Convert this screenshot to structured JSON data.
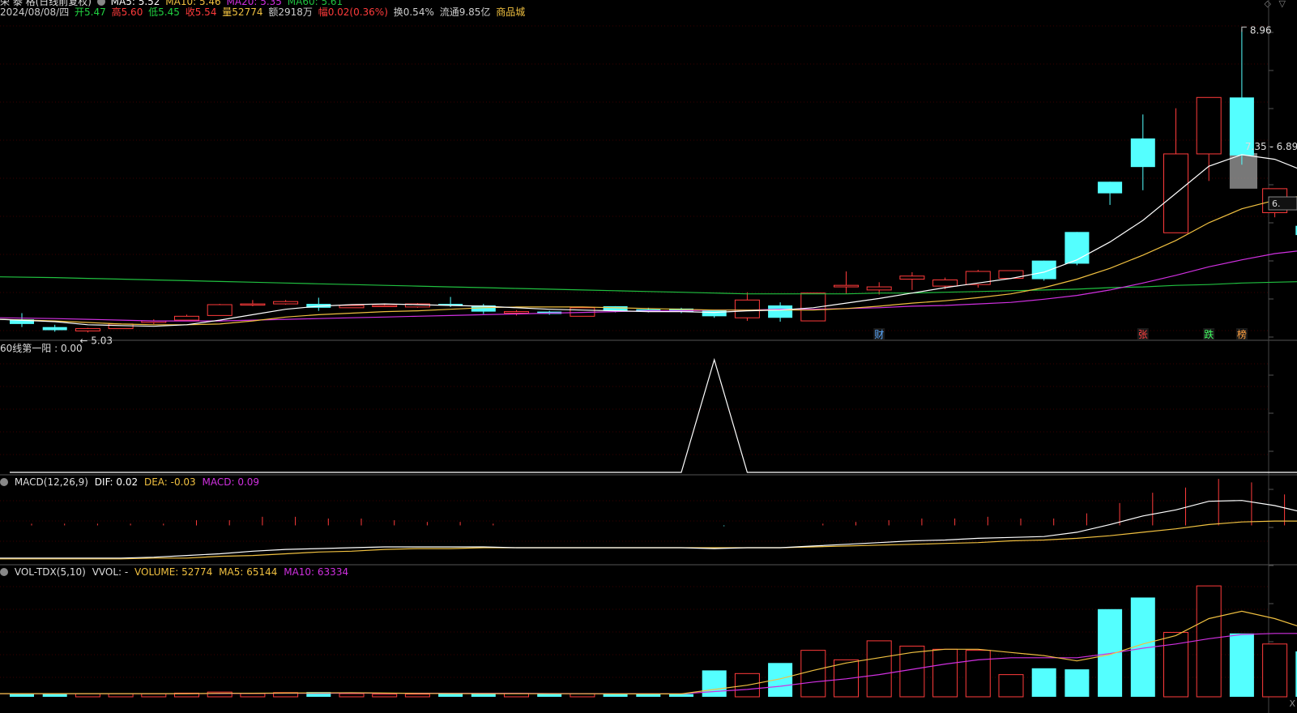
{
  "header": {
    "stock_name": "荣 泰 格(日线前复权)",
    "ma_row": [
      "MA5: 5.52",
      "MA10: 5.46",
      "MA20: 5.35",
      "MA60: 5.61"
    ],
    "date": "2024/08/08/四",
    "open": "开5.47",
    "high": "高5.60",
    "low": "低5.45",
    "close": "收5.54",
    "volume": "量52774",
    "amount": "额2918万",
    "change": "幅0.02(0.36%)",
    "turnover": "换0.54%",
    "float": "流通9.85亿",
    "category": "商品城"
  },
  "colors": {
    "up": "#ff3b3b",
    "down": "#54ffff",
    "ma5": "#ffffff",
    "ma10": "#f0c040",
    "ma20": "#d030e0",
    "ma60": "#20c040",
    "grid": "#3a0000",
    "text": "#cccccc"
  },
  "chart_data": [
    {
      "type": "candlestick",
      "name": "price",
      "candles": [
        {
          "o": 5.2,
          "h": 5.28,
          "l": 5.1,
          "c": 5.14
        },
        {
          "o": 5.1,
          "h": 5.13,
          "l": 5.04,
          "c": 5.06
        },
        {
          "o": 5.05,
          "h": 5.09,
          "l": 5.03,
          "c": 5.08
        },
        {
          "o": 5.08,
          "h": 5.15,
          "l": 5.08,
          "c": 5.14
        },
        {
          "o": 5.16,
          "h": 5.2,
          "l": 5.14,
          "c": 5.18
        },
        {
          "o": 5.19,
          "h": 5.26,
          "l": 5.18,
          "c": 5.24
        },
        {
          "o": 5.25,
          "h": 5.4,
          "l": 5.25,
          "c": 5.39
        },
        {
          "o": 5.4,
          "h": 5.45,
          "l": 5.37,
          "c": 5.4
        },
        {
          "o": 5.4,
          "h": 5.45,
          "l": 5.39,
          "c": 5.43
        },
        {
          "o": 5.4,
          "h": 5.48,
          "l": 5.31,
          "c": 5.35
        },
        {
          "o": 5.35,
          "h": 5.39,
          "l": 5.35,
          "c": 5.38
        },
        {
          "o": 5.38,
          "h": 5.4,
          "l": 5.36,
          "c": 5.38
        },
        {
          "o": 5.36,
          "h": 5.41,
          "l": 5.35,
          "c": 5.4
        },
        {
          "o": 5.4,
          "h": 5.49,
          "l": 5.36,
          "c": 5.38
        },
        {
          "o": 5.38,
          "h": 5.4,
          "l": 5.27,
          "c": 5.3
        },
        {
          "o": 5.28,
          "h": 5.32,
          "l": 5.25,
          "c": 5.3
        },
        {
          "o": 5.3,
          "h": 5.31,
          "l": 5.26,
          "c": 5.27
        },
        {
          "o": 5.24,
          "h": 5.36,
          "l": 5.24,
          "c": 5.35
        },
        {
          "o": 5.37,
          "h": 5.37,
          "l": 5.29,
          "c": 5.31
        },
        {
          "o": 5.33,
          "h": 5.35,
          "l": 5.29,
          "c": 5.3
        },
        {
          "o": 5.34,
          "h": 5.35,
          "l": 5.28,
          "c": 5.3
        },
        {
          "o": 5.32,
          "h": 5.32,
          "l": 5.22,
          "c": 5.24
        },
        {
          "o": 5.22,
          "h": 5.55,
          "l": 5.18,
          "c": 5.45
        },
        {
          "o": 5.38,
          "h": 5.42,
          "l": 5.17,
          "c": 5.22
        },
        {
          "o": 5.18,
          "h": 5.54,
          "l": 5.18,
          "c": 5.54
        },
        {
          "o": 5.62,
          "h": 5.82,
          "l": 5.53,
          "c": 5.64
        },
        {
          "o": 5.58,
          "h": 5.68,
          "l": 5.52,
          "c": 5.62
        },
        {
          "o": 5.72,
          "h": 5.81,
          "l": 5.58,
          "c": 5.76
        },
        {
          "o": 5.63,
          "h": 5.74,
          "l": 5.59,
          "c": 5.71
        },
        {
          "o": 5.65,
          "h": 5.84,
          "l": 5.61,
          "c": 5.82
        },
        {
          "o": 5.73,
          "h": 5.83,
          "l": 5.72,
          "c": 5.83
        },
        {
          "o": 5.96,
          "h": 5.96,
          "l": 5.7,
          "c": 5.72
        },
        {
          "o": 6.33,
          "h": 6.33,
          "l": 5.9,
          "c": 5.92
        },
        {
          "o": 6.98,
          "h": 6.98,
          "l": 6.68,
          "c": 6.83
        },
        {
          "o": 7.54,
          "h": 7.85,
          "l": 6.87,
          "c": 7.17
        },
        {
          "o": 6.32,
          "h": 7.93,
          "l": 6.32,
          "c": 7.34
        },
        {
          "o": 7.34,
          "h": 8.07,
          "l": 6.99,
          "c": 8.07
        },
        {
          "o": 8.07,
          "h": 8.96,
          "l": 7.2,
          "c": 7.32
        },
        {
          "o": 6.58,
          "h": 6.89,
          "l": 6.52,
          "c": 6.89
        },
        {
          "o": 6.41,
          "h": 6.58,
          "l": 6.23,
          "c": 6.29
        },
        {
          "o": 6.26,
          "h": 6.26,
          "l": 5.9,
          "c": 5.9
        }
      ],
      "ma5": [
        5.2,
        5.17,
        5.13,
        5.12,
        5.11,
        5.13,
        5.19,
        5.26,
        5.33,
        5.37,
        5.39,
        5.4,
        5.39,
        5.38,
        5.37,
        5.35,
        5.33,
        5.32,
        5.31,
        5.3,
        5.3,
        5.29,
        5.31,
        5.32,
        5.35,
        5.41,
        5.47,
        5.54,
        5.61,
        5.67,
        5.73,
        5.81,
        5.97,
        6.2,
        6.48,
        6.83,
        7.18,
        7.33,
        7.27,
        7.1,
        6.69
      ],
      "ma10": [
        5.2,
        5.18,
        5.16,
        5.14,
        5.13,
        5.13,
        5.14,
        5.18,
        5.23,
        5.26,
        5.28,
        5.3,
        5.31,
        5.33,
        5.35,
        5.36,
        5.36,
        5.36,
        5.35,
        5.34,
        5.33,
        5.32,
        5.32,
        5.32,
        5.32,
        5.34,
        5.37,
        5.41,
        5.44,
        5.48,
        5.53,
        5.61,
        5.72,
        5.86,
        6.03,
        6.22,
        6.45,
        6.63,
        6.74,
        6.81,
        6.77
      ],
      "ma20": [
        5.22,
        5.21,
        5.2,
        5.19,
        5.18,
        5.18,
        5.18,
        5.19,
        5.2,
        5.21,
        5.22,
        5.23,
        5.24,
        5.25,
        5.26,
        5.27,
        5.28,
        5.29,
        5.3,
        5.31,
        5.31,
        5.32,
        5.32,
        5.33,
        5.33,
        5.34,
        5.35,
        5.37,
        5.38,
        5.4,
        5.42,
        5.46,
        5.51,
        5.58,
        5.67,
        5.77,
        5.88,
        5.97,
        6.05,
        6.1,
        6.11
      ],
      "ma60": [
        5.75,
        5.74,
        5.73,
        5.72,
        5.71,
        5.7,
        5.69,
        5.68,
        5.67,
        5.66,
        5.65,
        5.64,
        5.63,
        5.62,
        5.61,
        5.6,
        5.59,
        5.58,
        5.57,
        5.56,
        5.55,
        5.54,
        5.53,
        5.53,
        5.53,
        5.53,
        5.54,
        5.54,
        5.55,
        5.56,
        5.57,
        5.58,
        5.59,
        5.61,
        5.62,
        5.64,
        5.65,
        5.67,
        5.68,
        5.69,
        5.7
      ],
      "ylim": [
        4.95,
        9.1
      ],
      "annotations": {
        "high_label": "8.96",
        "low_label": "← 5.03",
        "zone1_label": "7.35 - 6.89",
        "zone2_label": "6.62 - 6.52",
        "right_tick": "6."
      },
      "event_markers": [
        {
          "index": 26,
          "text": "财",
          "color": "#5aa8ff"
        },
        {
          "index": 34,
          "text": "张",
          "color": "#ff4040"
        },
        {
          "index": 36,
          "text": "跌",
          "color": "#40ff60"
        },
        {
          "index": 37,
          "text": "榜",
          "color": "#ffa040"
        }
      ]
    },
    {
      "type": "line",
      "name": "60线第一阳",
      "title": "60线第一阳 : 0.00",
      "values": [
        0,
        0,
        0,
        0,
        0,
        0,
        0,
        0,
        0,
        0,
        0,
        0,
        0,
        0,
        0,
        0,
        0,
        0,
        0,
        0,
        0,
        1,
        0,
        0,
        0,
        0,
        0,
        0,
        0,
        0,
        0,
        0,
        0,
        0,
        0,
        0,
        0,
        0,
        0,
        0,
        0
      ],
      "ylim": [
        0,
        1
      ]
    },
    {
      "type": "macd",
      "name": "MACD",
      "title_params": "MACD(12,26,9)",
      "dif_label": "DIF: 0.02",
      "dea_label": "DEA: -0.03",
      "macd_label": "MACD: 0.09",
      "dif": [
        -0.38,
        -0.38,
        -0.38,
        -0.38,
        -0.37,
        -0.35,
        -0.33,
        -0.3,
        -0.28,
        -0.27,
        -0.26,
        -0.25,
        -0.25,
        -0.25,
        -0.25,
        -0.26,
        -0.26,
        -0.26,
        -0.26,
        -0.26,
        -0.26,
        -0.27,
        -0.26,
        -0.26,
        -0.24,
        -0.22,
        -0.2,
        -0.18,
        -0.17,
        -0.15,
        -0.14,
        -0.13,
        -0.08,
        0.01,
        0.11,
        0.18,
        0.28,
        0.29,
        0.23,
        0.14,
        0.02
      ],
      "dea": [
        -0.39,
        -0.39,
        -0.39,
        -0.39,
        -0.38,
        -0.38,
        -0.36,
        -0.35,
        -0.33,
        -0.31,
        -0.3,
        -0.28,
        -0.27,
        -0.27,
        -0.26,
        -0.26,
        -0.26,
        -0.26,
        -0.26,
        -0.26,
        -0.26,
        -0.26,
        -0.26,
        -0.26,
        -0.25,
        -0.24,
        -0.23,
        -0.22,
        -0.21,
        -0.2,
        -0.18,
        -0.17,
        -0.15,
        -0.12,
        -0.08,
        -0.04,
        0.01,
        0.04,
        0.05,
        0.05,
        -0.03
      ],
      "macd": [
        0.02,
        0.02,
        0.02,
        0.02,
        0.02,
        0.06,
        0.06,
        0.1,
        0.1,
        0.08,
        0.08,
        0.06,
        0.04,
        0.04,
        0.02,
        0.0,
        0.0,
        0.0,
        0.0,
        0.0,
        0.0,
        -0.01,
        0.0,
        0.0,
        0.02,
        0.04,
        0.06,
        0.08,
        0.08,
        0.1,
        0.08,
        0.08,
        0.14,
        0.26,
        0.38,
        0.44,
        0.54,
        0.5,
        0.36,
        0.18,
        -0.12
      ],
      "ylim": [
        -0.42,
        0.4
      ]
    },
    {
      "type": "bar",
      "name": "VOL-TDX",
      "title_params": "VOL-TDX(5,10)",
      "vvol_label": "VVOL: -",
      "volume_label": "VOLUME: 52774",
      "ma5_label": "MA5: 65144",
      "ma10_label": "MA10: 63334",
      "values": [
        3000,
        3000,
        3000,
        3000,
        2800,
        3500,
        4500,
        3000,
        4000,
        4500,
        3000,
        2500,
        2500,
        3500,
        3200,
        3200,
        2700,
        3000,
        2800,
        2800,
        2600,
        25000,
        22000,
        32000,
        44000,
        35000,
        53000,
        48000,
        45000,
        44000,
        21000,
        27000,
        26000,
        83000,
        94000,
        61000,
        105000,
        60000,
        50000,
        43000,
        30000
      ],
      "ma5": [
        3000,
        3000,
        3000,
        3000,
        3000,
        3000,
        3300,
        3400,
        3500,
        3700,
        3800,
        3500,
        3200,
        3100,
        3000,
        3000,
        2900,
        2900,
        2800,
        2800,
        2800,
        7000,
        11000,
        17000,
        25000,
        32000,
        37000,
        42000,
        45000,
        45000,
        42000,
        39000,
        34000,
        40000,
        50000,
        58000,
        74000,
        81000,
        74000,
        64000,
        57000
      ],
      "ma10": [
        3000,
        3000,
        3000,
        3000,
        3000,
        3000,
        3100,
        3200,
        3300,
        3400,
        3500,
        3400,
        3400,
        3300,
        3300,
        3300,
        3100,
        3000,
        2900,
        2900,
        2800,
        5000,
        7000,
        10000,
        14000,
        17000,
        21000,
        26000,
        31000,
        35000,
        37000,
        37000,
        37000,
        41000,
        46000,
        50000,
        55000,
        59000,
        60000,
        60000,
        61000
      ],
      "ylim": [
        0,
        112000
      ]
    }
  ]
}
